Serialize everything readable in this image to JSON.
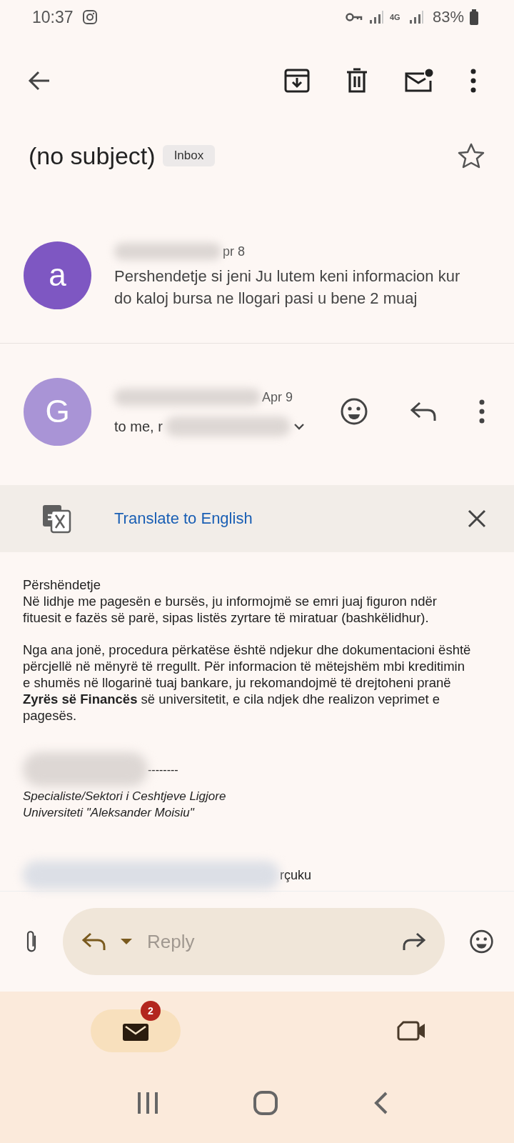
{
  "status_bar": {
    "time": "10:37",
    "network": "4G",
    "battery": "83%"
  },
  "subject": {
    "title": "(no subject)",
    "label": "Inbox",
    "starred": false
  },
  "messages": [
    {
      "avatar": "a",
      "color": "#7e57c2",
      "date": "pr 8",
      "snippet": "Pershendetje si jeni Ju lutem keni informacion kur do kaloj bursa ne llogari pasi u bene 2 muaj"
    },
    {
      "avatar": "G",
      "color": "#a994d6",
      "date": "Apr 9",
      "recipients": "to me, r"
    }
  ],
  "translate_bar": {
    "label": "Translate to English"
  },
  "body": {
    "greeting": "Përshëndetje",
    "paragraphs": [
      "Në lidhje me pagesën e bursës, ju informojmë se emri juaj figuron ndër fituesit e fazës së parë, sipas listës zyrtare të miratuar (bashkëlidhur).",
      "Nga ana jonë, procedura përkatëse është ndjekur dhe dokumentacioni është përcjellë në mënyrë të rregullt. Për informacion të mëtejshëm mbi kreditimin e shumës në llogarinë tuaj bankare, ju rekomandojmë të drejtoheni pranë **Zyrës së Financës** së universitetit, e cila ndjek dhe realizon veprimet e pagesës."
    ],
    "signature_rule": "--------",
    "signature": [
      "Specialiste/Sektori i Ceshtjeve Ligjore",
      "Universiteti \"Aleksander Moisiu\""
    ],
    "footer": "rçuku"
  },
  "reply_bar": {
    "placeholder": "Reply"
  },
  "bottom_nav": [
    {
      "kind": "mail",
      "badge": "2",
      "selected": true
    },
    {
      "kind": "video",
      "selected": false
    }
  ]
}
